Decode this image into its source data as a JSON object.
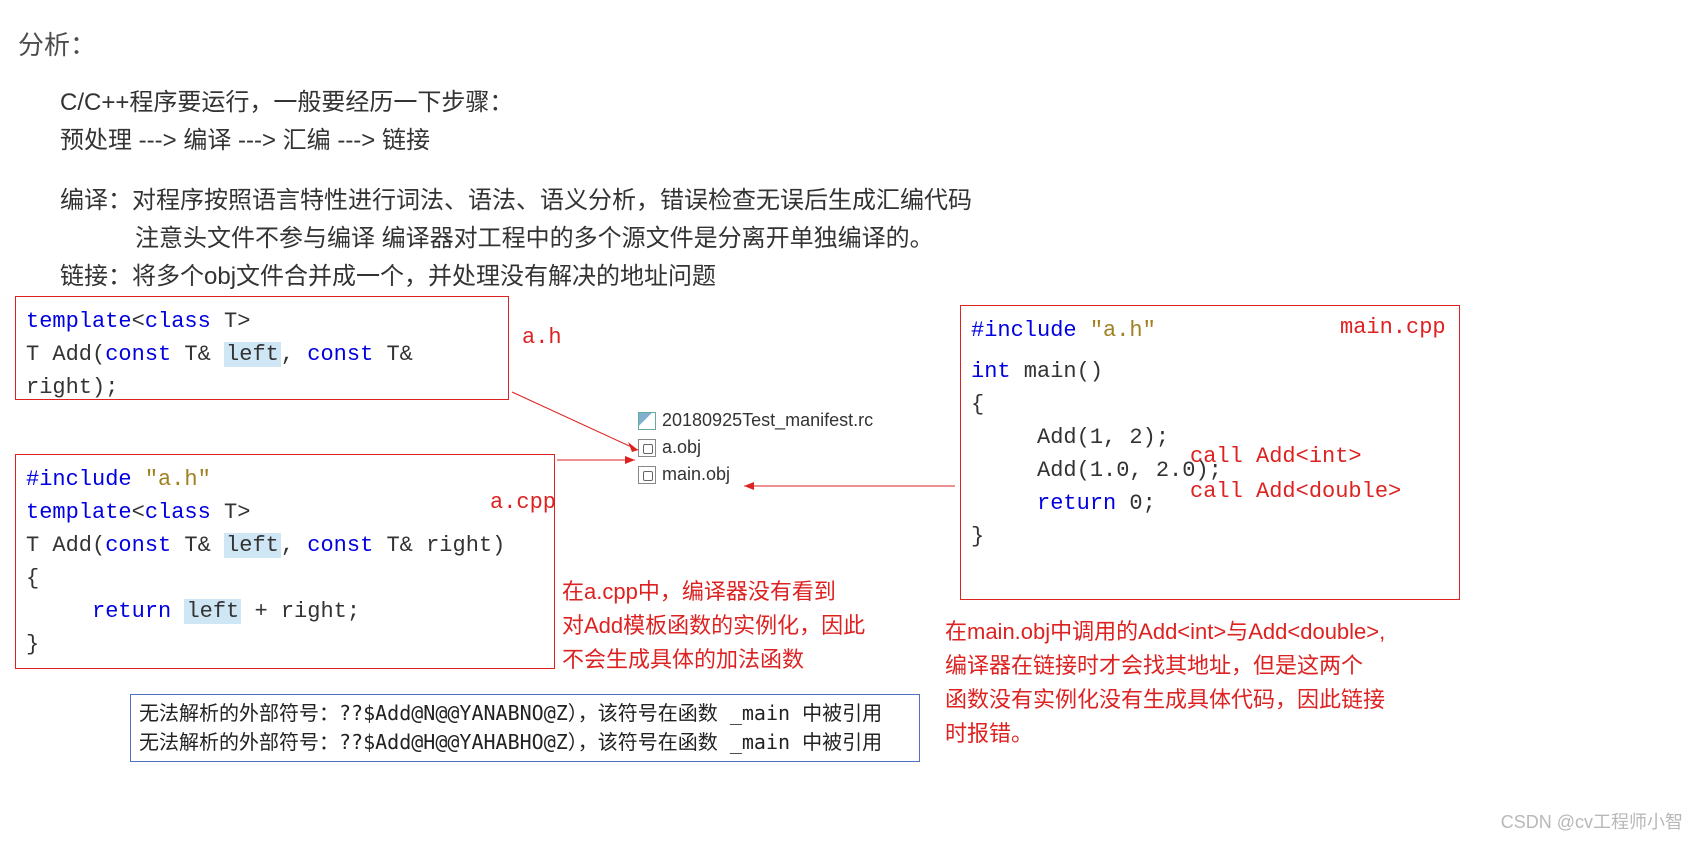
{
  "title": "分析：",
  "line1": "C/C++程序要运行，一般要经历一下步骤：",
  "line2": "预处理 ---> 编译 ---> 汇编 ---> 链接",
  "line3": "编译：对程序按照语言特性进行词法、语法、语义分析，错误检查无误后生成汇编代码",
  "line4": "注意头文件不参与编译  编译器对工程中的多个源文件是分离开单独编译的。",
  "line5": "链接：将多个obj文件合并成一个，并处理没有解决的地址问题",
  "ah": {
    "label": "a.h",
    "l1a": "template",
    "l1b": "<",
    "l1c": "class",
    "l1d": " T>",
    "l2a": "T Add(",
    "l2b": "const",
    "l2c": " T& ",
    "l2d": "left",
    "l2e": ", ",
    "l2f": "const",
    "l2g": " T& right);"
  },
  "acpp": {
    "label": "a.cpp",
    "l1": "#include ",
    "l1s": "\"a.h\"",
    "l2a": "template",
    "l2b": "<",
    "l2c": "class",
    "l2d": " T>",
    "l3a": "T Add(",
    "l3b": "const",
    "l3c": " T& ",
    "l3d": "left",
    "l3e": ", ",
    "l3f": "const",
    "l3g": " T& right)",
    "l4": "{",
    "l5a": "return",
    "l5b": " ",
    "l5c": "left",
    "l5d": " + right;",
    "l6": "}"
  },
  "maincpp": {
    "label": "main.cpp",
    "l1": "#include ",
    "l1s": "\"a.h\"",
    "l2a": "int",
    "l2b": " main()",
    "l3": "{",
    "l4a": "Add(1, 2);",
    "l4c": "call Add<int>",
    "l5a": "Add(1.0, 2.0);",
    "l5c": "call Add<double>",
    "l6a": "return",
    "l6b": " 0;",
    "l7": "}"
  },
  "files": {
    "f1": "20180925Test_manifest.rc",
    "f2": "a.obj",
    "f3": "main.obj"
  },
  "note_a_l1": "在a.cpp中，编译器没有看到",
  "note_a_l2": "对Add模板函数的实例化，因此",
  "note_a_l3": "不会生成具体的加法函数",
  "note_m_l1": "在main.obj中调用的Add<int>与Add<double>,",
  "note_m_l2": "编译器在链接时才会找其地址，但是这两个",
  "note_m_l3": "函数没有实例化没有生成具体代码，因此链接",
  "note_m_l4": "时报错。",
  "err1": "无法解析的外部符号：??$Add@N@@YANABNO@Z），该符号在函数 _main 中被引用",
  "err2": "无法解析的外部符号：??$Add@H@@YAHABHO@Z），该符号在函数 _main 中被引用",
  "watermark": "CSDN @cv工程师小智"
}
